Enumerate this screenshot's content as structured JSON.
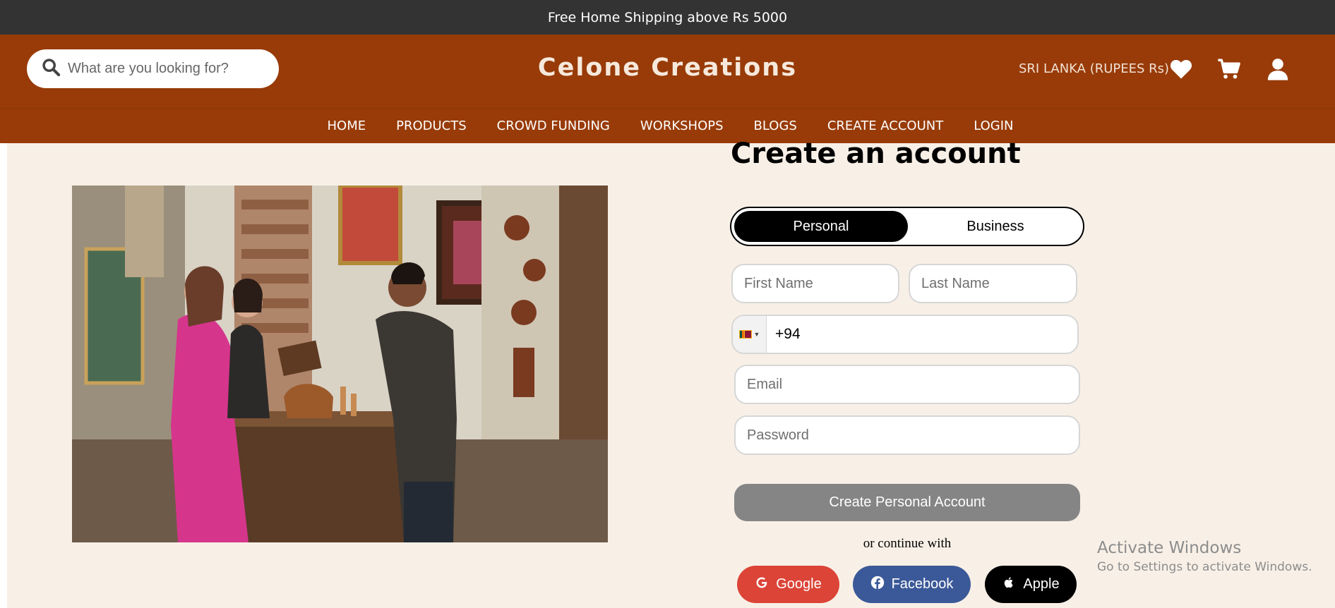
{
  "topbar": {
    "announcement": "Free Home Shipping above Rs 5000"
  },
  "header": {
    "search_placeholder": "What are you looking for?",
    "brand": "Celone Creations",
    "currency": "SRI LANKA (RUPEES Rs)",
    "icons": [
      "heart-icon",
      "cart-icon",
      "user-icon"
    ]
  },
  "nav": {
    "items": [
      "HOME",
      "PRODUCTS",
      "CROWD FUNDING",
      "WORKSHOPS",
      "BLOGS",
      "CREATE ACCOUNT",
      "LOGIN"
    ]
  },
  "form": {
    "title": "Create an account",
    "tabs": {
      "personal": "Personal",
      "business": "Business",
      "active": "Personal"
    },
    "first_name_placeholder": "First Name",
    "last_name_placeholder": "Last Name",
    "phone_value": "+94",
    "email_placeholder": "Email",
    "password_placeholder": "Password",
    "submit_label": "Create Personal Account",
    "or_text": "or continue with",
    "social": {
      "google": "Google",
      "facebook": "Facebook",
      "apple": "Apple"
    }
  },
  "watermark": {
    "title": "Activate Windows",
    "subtitle": "Go to Settings to activate Windows."
  },
  "colors": {
    "header": "#983b08",
    "topbar": "#333333",
    "background": "#f8f0e7",
    "google": "#db4437",
    "facebook": "#3b5998",
    "apple": "#000000"
  }
}
